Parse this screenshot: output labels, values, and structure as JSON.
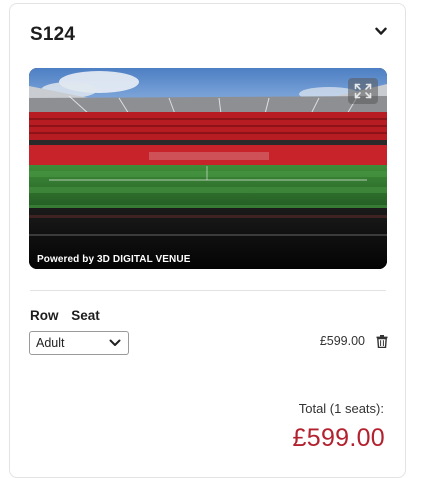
{
  "section": {
    "title": "S124"
  },
  "venue_view": {
    "powered_by": "Powered by 3D DIGITAL VENUE",
    "expand_icon": "expand-arrows-icon",
    "collapse_icon": "chevron-down-icon"
  },
  "seat_table": {
    "row_header": "Row",
    "seat_header": "Seat",
    "ticket_type": {
      "selected": "Adult"
    },
    "price": "£599.00",
    "remove_icon": "trash-icon"
  },
  "summary": {
    "total_label": "Total (1 seats):",
    "total_amount": "£599.00"
  },
  "colors": {
    "accent_price": "#b3212f",
    "stand_red": "#c21d24",
    "pitch_green": "#2f7a2f"
  }
}
